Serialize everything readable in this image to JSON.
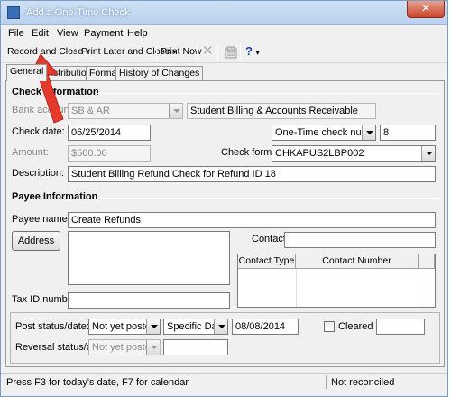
{
  "window": {
    "title": "Add a One-Time Check",
    "close_glyph": "✕"
  },
  "menu": {
    "file": "File",
    "edit": "Edit",
    "view": "View",
    "payment": "Payment",
    "help": "Help"
  },
  "toolbar": {
    "record_close": "Record and Close",
    "print_later_close": "Print Later and Close",
    "print_now": "Print Now",
    "help_glyph": "?",
    "delete_glyph": "✕"
  },
  "tabs": [
    "General",
    "Distribution",
    "Format",
    "History of Changes"
  ],
  "check_info": {
    "section_title": "Check Information",
    "bank_account_label": "Bank account:",
    "bank_account_value": "SB & AR",
    "bank_account_desc": "Student Billing & Accounts Receivable",
    "check_date_label": "Check date:",
    "check_date_value": "06/25/2014",
    "check_number_type": "One-Time check number",
    "check_number_value": "8",
    "amount_label": "Amount:",
    "amount_value": "$500.00",
    "check_format_label": "Check format:",
    "check_format_value": "CHKAPUS2LBP002",
    "description_label": "Description:",
    "description_value": "Student Billing Refund Check for Refund ID 18"
  },
  "payee": {
    "section_title": "Payee Information",
    "payee_name_label": "Payee name:",
    "payee_name_value": "Create Refunds",
    "address_button": "Address",
    "contact_label": "Contact:",
    "contact_value": "",
    "grid_headers": [
      "Contact Type",
      "Contact Number"
    ],
    "tax_id_label": "Tax ID number:",
    "tax_id_value": ""
  },
  "posting": {
    "post_status_label": "Post status/date:",
    "post_status_value": "Not yet posted",
    "post_date_mode": "Specific Date",
    "post_date_value": "08/08/2014",
    "cleared_label": "Cleared on",
    "cleared_value": "",
    "reversal_label": "Reversal status/date:",
    "reversal_status_value": "Not yet posted",
    "reversal_date_value": ""
  },
  "status": {
    "hint": "Press F3 for today's date, F7 for calendar",
    "reconcile": "Not reconciled"
  },
  "colors": {
    "annotation_arrow": "#e33a2c",
    "titlebar": "#b9d1ee",
    "help_icon": "#1a3fa6"
  }
}
